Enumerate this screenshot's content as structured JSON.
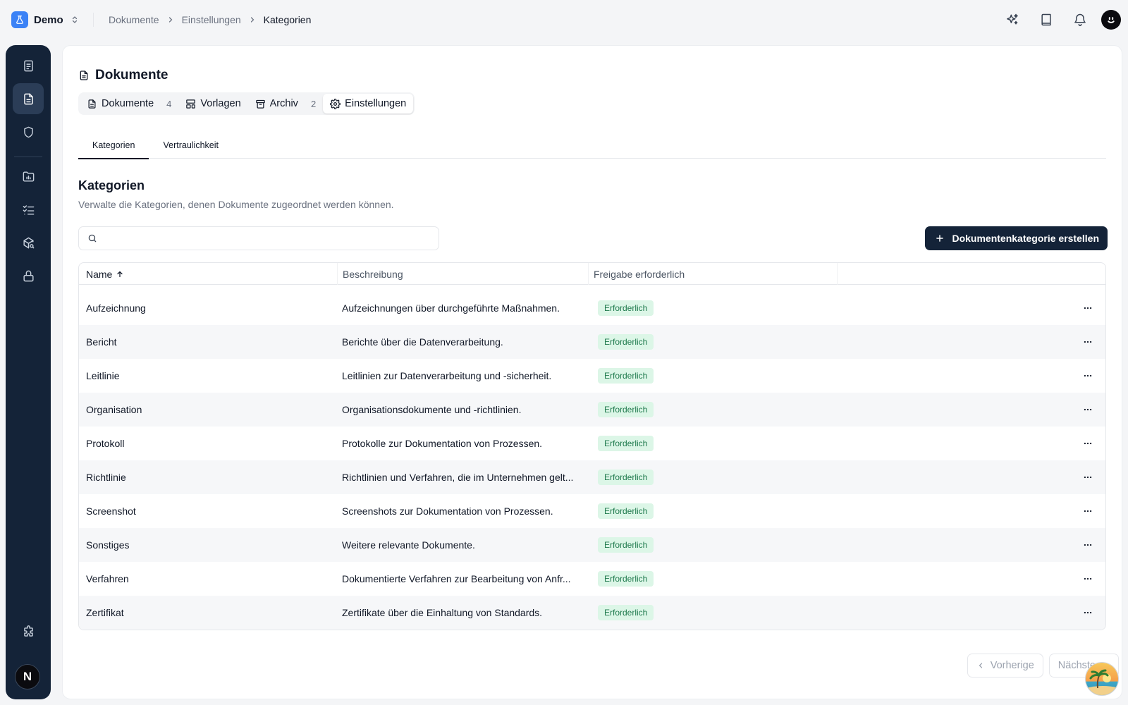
{
  "workspace": {
    "name": "Demo"
  },
  "breadcrumb": [
    "Dokumente",
    "Einstellungen",
    "Kategorien"
  ],
  "page": {
    "title": "Dokumente"
  },
  "tabs": [
    {
      "label": "Dokumente",
      "count": "4",
      "icon": "file-icon"
    },
    {
      "label": "Vorlagen",
      "count": "",
      "icon": "template-icon"
    },
    {
      "label": "Archiv",
      "count": "2",
      "icon": "archive-icon"
    },
    {
      "label": "Einstellungen",
      "count": "",
      "icon": "gear-icon"
    }
  ],
  "subtabs": [
    "Kategorien",
    "Vertraulichkeit"
  ],
  "section": {
    "title": "Kategorien",
    "description": "Verwalte die Kategorien, denen Dokumente zugeordnet werden können."
  },
  "search": {
    "placeholder": ""
  },
  "create_button": {
    "label": "Dokumentenkategorie erstellen"
  },
  "table": {
    "columns": [
      "Name",
      "Beschreibung",
      "Freigabe erforderlich"
    ],
    "rows": [
      {
        "name": "Aufzeichnung",
        "description": "Aufzeichnungen über durchgeführte Maßnahmen.",
        "approval": "Erforderlich"
      },
      {
        "name": "Bericht",
        "description": "Berichte über die Datenverarbeitung.",
        "approval": "Erforderlich"
      },
      {
        "name": "Leitlinie",
        "description": "Leitlinien zur Datenverarbeitung und -sicherheit.",
        "approval": "Erforderlich"
      },
      {
        "name": "Organisation",
        "description": "Organisationsdokumente und -richtlinien.",
        "approval": "Erforderlich"
      },
      {
        "name": "Protokoll",
        "description": "Protokolle zur Dokumentation von Prozessen.",
        "approval": "Erforderlich"
      },
      {
        "name": "Richtlinie",
        "description": "Richtlinien und Verfahren, die im Unternehmen gelt...",
        "approval": "Erforderlich"
      },
      {
        "name": "Screenshot",
        "description": "Screenshots zur Dokumentation von Prozessen.",
        "approval": "Erforderlich"
      },
      {
        "name": "Sonstiges",
        "description": "Weitere relevante Dokumente.",
        "approval": "Erforderlich"
      },
      {
        "name": "Verfahren",
        "description": "Dokumentierte Verfahren zur Bearbeitung von Anfr...",
        "approval": "Erforderlich"
      },
      {
        "name": "Zertifikat",
        "description": "Zertifikate über die Einhaltung von Standards.",
        "approval": "Erforderlich"
      }
    ]
  },
  "pagination": {
    "prev": "Vorherige",
    "next": "Nächste"
  },
  "sidebar": {
    "items": [
      "tasks-icon",
      "document-icon",
      "shield-icon",
      "folder-chart-icon",
      "checklist-icon",
      "package-search-icon",
      "lock-icon"
    ],
    "bottom": [
      "puzzle-icon"
    ],
    "user_initial": "N"
  },
  "colors": {
    "primary": "#142338",
    "accent": "#3b82f6",
    "badge_bg": "#dcf6e7",
    "badge_text": "#1f7a4d"
  }
}
